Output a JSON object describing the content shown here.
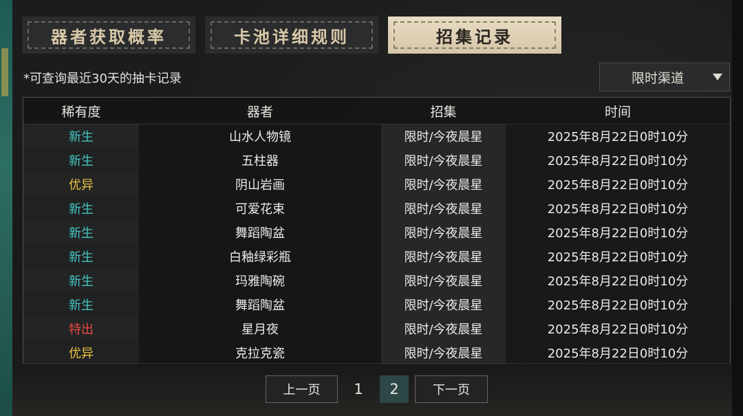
{
  "tabs": [
    {
      "label": "器者获取概率",
      "active": false
    },
    {
      "label": "卡池详细规则",
      "active": false
    },
    {
      "label": "招集记录",
      "active": true
    }
  ],
  "note": "*可查询最近30天的抽卡记录",
  "channel_filter": {
    "selected": "限时渠道"
  },
  "table": {
    "headers": [
      "稀有度",
      "器者",
      "招集",
      "时间"
    ],
    "rows": [
      {
        "rarity": "新生",
        "rarity_type": "new",
        "item": "山水人物镜",
        "pool": "限时/今夜晨星",
        "time": "2025年8月22日0时10分"
      },
      {
        "rarity": "新生",
        "rarity_type": "new",
        "item": "五柱器",
        "pool": "限时/今夜晨星",
        "time": "2025年8月22日0时10分"
      },
      {
        "rarity": "优异",
        "rarity_type": "good",
        "item": "阴山岩画",
        "pool": "限时/今夜晨星",
        "time": "2025年8月22日0时10分"
      },
      {
        "rarity": "新生",
        "rarity_type": "new",
        "item": "可爱花束",
        "pool": "限时/今夜晨星",
        "time": "2025年8月22日0时10分"
      },
      {
        "rarity": "新生",
        "rarity_type": "new",
        "item": "舞蹈陶盆",
        "pool": "限时/今夜晨星",
        "time": "2025年8月22日0时10分"
      },
      {
        "rarity": "新生",
        "rarity_type": "new",
        "item": "白釉绿彩瓶",
        "pool": "限时/今夜晨星",
        "time": "2025年8月22日0时10分"
      },
      {
        "rarity": "新生",
        "rarity_type": "new",
        "item": "玛雅陶碗",
        "pool": "限时/今夜晨星",
        "time": "2025年8月22日0时10分"
      },
      {
        "rarity": "新生",
        "rarity_type": "new",
        "item": "舞蹈陶盆",
        "pool": "限时/今夜晨星",
        "time": "2025年8月22日0时10分"
      },
      {
        "rarity": "特出",
        "rarity_type": "special",
        "item": "星月夜",
        "pool": "限时/今夜晨星",
        "time": "2025年8月22日0时10分"
      },
      {
        "rarity": "优异",
        "rarity_type": "good",
        "item": "克拉克瓷",
        "pool": "限时/今夜晨星",
        "time": "2025年8月22日0时10分"
      }
    ]
  },
  "pagination": {
    "prev_label": "上一页",
    "next_label": "下一页",
    "pages": [
      "1",
      "2"
    ],
    "current": "2"
  },
  "colors": {
    "rarity_new": "#45c4c2",
    "rarity_good": "#e9c444",
    "rarity_special": "#e84a42",
    "active_tab": "#e0d3b8"
  },
  "icons": {
    "dropdown": "triangle-down-icon"
  }
}
